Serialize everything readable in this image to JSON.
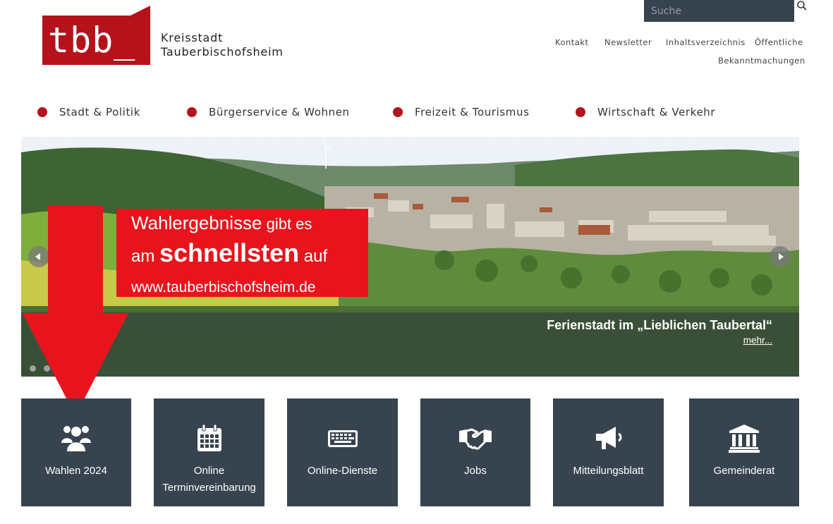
{
  "logo": {
    "text": "tbb_",
    "color": "#b5121b"
  },
  "site_name": {
    "line1": "Kreisstadt",
    "line2": "Tauberbischofsheim"
  },
  "search": {
    "placeholder": "Suche",
    "icon": "search-icon"
  },
  "top_links": {
    "kontakt": "Kontakt",
    "newsletter": "Newsletter",
    "inhalt": "Inhaltsverzeichnis",
    "oeff1": "Öffentliche",
    "oeff2": "Bekanntmachungen"
  },
  "nav": [
    {
      "label": "Stadt & Politik"
    },
    {
      "label": "Bürgerservice & Wohnen"
    },
    {
      "label": "Freizeit & Tourismus"
    },
    {
      "label": "Wirtschaft & Verkehr"
    }
  ],
  "hero": {
    "caption": "Ferienstadt im „Lieblichen Taubertal“",
    "more": "mehr..."
  },
  "notice": {
    "l1a": "Wahlergebnisse",
    "l1b": " gibt es",
    "l2a": "am ",
    "l2b": "schnellsten",
    "l2c": " auf",
    "l3": "www.tauberbischofsheim.de",
    "color": "#e8141d"
  },
  "tiles": [
    {
      "label": "Wahlen 2024",
      "icon": "users-icon"
    },
    {
      "label": "Online Terminvereinbarung",
      "icon": "calendar-icon"
    },
    {
      "label": "Online-Dienste",
      "icon": "keyboard-icon"
    },
    {
      "label": "Jobs",
      "icon": "handshake-icon"
    },
    {
      "label": "Mitteilungsblatt",
      "icon": "megaphone-icon"
    },
    {
      "label": "Gemeinderat",
      "icon": "institution-icon"
    }
  ],
  "colors": {
    "tile": "#37444f",
    "accent": "#b5121b"
  }
}
